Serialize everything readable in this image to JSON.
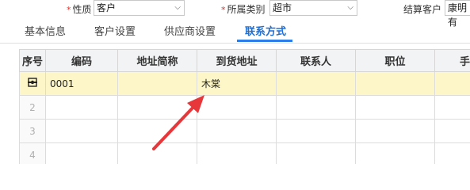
{
  "form": {
    "nature_label": "性质",
    "nature_value": "客户",
    "category_label": "所属类别",
    "category_value": "超市",
    "settle_label": "结算客户",
    "settle_value": "康明有"
  },
  "tabs": [
    "基本信息",
    "客户设置",
    "供应商设置",
    "联系方式"
  ],
  "active_tab": "联系方式",
  "table": {
    "headers": [
      "序号",
      "编码",
      "地址简称",
      "到货地址",
      "联系人",
      "职位",
      "手"
    ],
    "rows": [
      {
        "num": "",
        "code": "0001",
        "short": "",
        "address": "木棠",
        "contact": "",
        "position": "",
        "phone": ""
      },
      {
        "num": "2",
        "code": "",
        "short": "",
        "address": "",
        "contact": "",
        "position": "",
        "phone": ""
      },
      {
        "num": "3",
        "code": "",
        "short": "",
        "address": "",
        "contact": "",
        "position": "",
        "phone": ""
      },
      {
        "num": "4",
        "code": "",
        "short": "",
        "address": "",
        "contact": "",
        "position": "",
        "phone": ""
      }
    ]
  },
  "colors": {
    "accent": "#1f6fd6",
    "required": "#e0312b",
    "selected_row": "#fdf6c9",
    "arrow": "#e8373a"
  },
  "icons": {
    "row_edit": "gear-icon",
    "dropdown": "chevron-down-icon"
  }
}
